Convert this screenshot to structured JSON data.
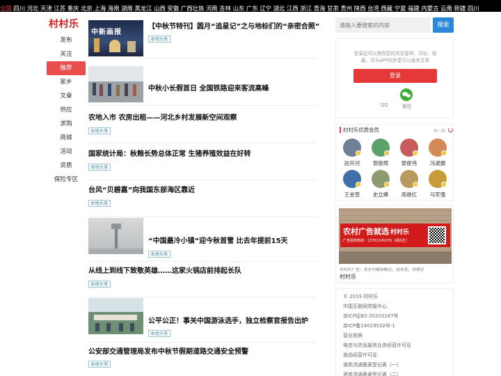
{
  "regions": [
    "全国",
    "四川",
    "河北",
    "天津",
    "江苏",
    "重庆",
    "北京",
    "上海",
    "海南",
    "湖南",
    "黑龙江",
    "山西",
    "安徽",
    "广西壮族",
    "河南",
    "吉林",
    "山东",
    "广东",
    "辽宁",
    "湖北",
    "江西",
    "浙江",
    "青海",
    "甘肃",
    "贵州",
    "陕西",
    "台湾",
    "西藏",
    "宁夏",
    "福建",
    "内蒙古",
    "云南",
    "新疆",
    "四川"
  ],
  "logo": "村村乐",
  "nav": [
    "发布",
    "关注",
    "推荐",
    "家乡",
    "文章",
    "供应",
    "求购",
    "商城",
    "活动",
    "资质",
    "保险专区"
  ],
  "nav_active": "推荐",
  "articles": [
    {
      "title": "【中秋节特刊】圆月“追星记”之与地标们的“亲密合照”",
      "tag": "本地头条",
      "thumb_text": "中新画报"
    },
    {
      "title": "中秋小长假首日 全国铁路迎来客流高峰",
      "tag": "",
      "thumb_text": ""
    },
    {
      "title": "农地入市 农房出租——河北乡村发展新空间观察",
      "tag": "本地头条"
    },
    {
      "title": "国家统计局：秋粮长势总体正常 生猪养殖效益在好转",
      "tag": "本地头条"
    },
    {
      "title": "台风“贝碧嘉”向我国东部海区靠近",
      "tag": "本地头条"
    },
    {
      "title": "“中国最冷小镇”迎今秋首雪 比去年提前15天",
      "tag": "本地头条"
    },
    {
      "title": "从线上到线下致敬英雄……这家火锅店前排起长队",
      "tag": "本地头条"
    },
    {
      "title": "公平公正！事关中国游泳选手，独立检察官报告出炉",
      "tag": "本地头条"
    },
    {
      "title": "公安部交通管理局发布中秋节假期道路交通安全预警",
      "tag": "本地头条"
    }
  ],
  "search": {
    "placeholder": "请输入要搜索的内容",
    "button": "搜索"
  },
  "login": {
    "tip": "登录后可以保存您的浏览量样、评论、收藏，并与APP同步更可以发布文章",
    "button": "登录",
    "qq": "QQ",
    "wechat": "微信"
  },
  "members": {
    "title": "村村乐优质会员",
    "refresh": "换一换",
    "list": [
      {
        "name": "赵开河",
        "color": "#6f7f96"
      },
      {
        "name": "郭俊辉",
        "color": "#5aa16a"
      },
      {
        "name": "郭俊伟",
        "color": "#c75b5b"
      },
      {
        "name": "冯淑娟",
        "color": "#d48a57"
      },
      {
        "name": "王金营",
        "color": "#3e6fa8"
      },
      {
        "name": "史立峰",
        "color": "#8c9c70"
      },
      {
        "name": "高继红",
        "color": "#b79a5e"
      },
      {
        "name": "马军强",
        "color": "#c79a3a"
      }
    ]
  },
  "ad": {
    "headline": "农村广告就选",
    "brand_in_img": "村村乐",
    "phone": "广告招商热线：13701241076（胡先生）",
    "desc": "村村乐广告：县乡村精准触达，成本低、效果好",
    "brand": "村村乐"
  },
  "footer": [
    "© 2019 村村乐",
    "中国互联网举报中心",
    "京ICP证B2-20203167号",
    "京ICP备14019532号-1",
    "营业执照",
    "电信与信息服务业务经营许可证",
    "食品经营许可证",
    "酒类流通备案登记表（一）",
    "酒类流通备案登记表（二）"
  ]
}
